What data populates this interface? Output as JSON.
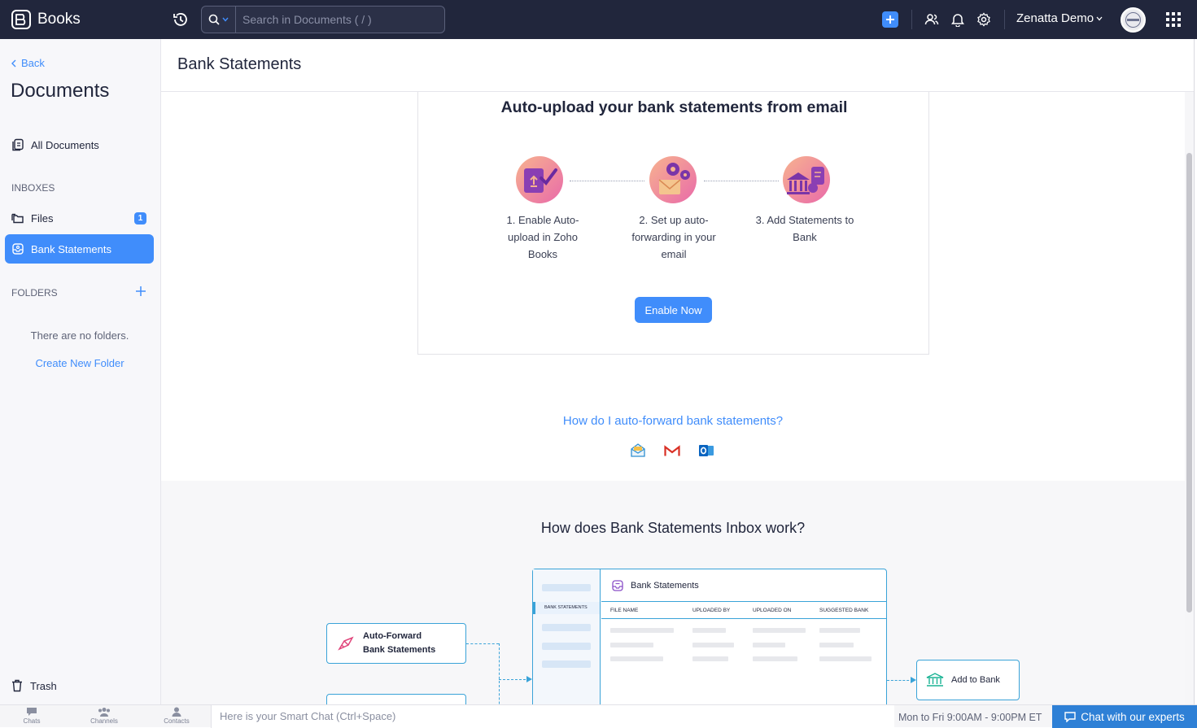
{
  "app": {
    "name": "Books"
  },
  "search": {
    "placeholder": "Search in Documents ( / )"
  },
  "topbar": {
    "org_name": "Zenatta Demo"
  },
  "sidebar": {
    "back_label": "Back",
    "title": "Documents",
    "all_documents": "All Documents",
    "inboxes_label": "INBOXES",
    "files_label": "Files",
    "files_count": "1",
    "bank_statements_label": "Bank Statements",
    "folders_label": "FOLDERS",
    "empty_folders": "There are no folders.",
    "create_folder": "Create New Folder",
    "trash_label": "Trash"
  },
  "page": {
    "title": "Bank Statements"
  },
  "card": {
    "title": "Auto-upload your bank statements from email",
    "steps": [
      {
        "label": "1. Enable Auto-upload in Zoho Books"
      },
      {
        "label": "2. Set up auto-forwarding in your email"
      },
      {
        "label": "3. Add Statements to Bank"
      }
    ],
    "enable_button": "Enable Now"
  },
  "howto_link": "How do I auto-forward bank statements?",
  "mail_icons": [
    "zoho-mail-icon",
    "gmail-icon",
    "outlook-icon"
  ],
  "works": {
    "title": "How does Bank Statements Inbox work?",
    "autoforward_line1": "Auto-Forward",
    "autoforward_line2": "Bank Statements",
    "mock_title": "Bank Statements",
    "mock_tag": "BANK STATEMENTS",
    "columns": [
      "FILE NAME",
      "UPLOADED BY",
      "UPLOADED ON",
      "SUGGESTED BANK"
    ],
    "add_to_bank": "Add to Bank"
  },
  "bottombar": {
    "chats": "Chats",
    "channels": "Channels",
    "contacts": "Contacts",
    "smartchat": "Here is your Smart Chat (Ctrl+Space)",
    "hours": "Mon to Fri 9:00AM - 9:00PM ET",
    "chat_button": "Chat with our experts"
  },
  "colors": {
    "accent": "#408dfb",
    "topbar": "#21263c",
    "flow": "#3aa3d8"
  }
}
